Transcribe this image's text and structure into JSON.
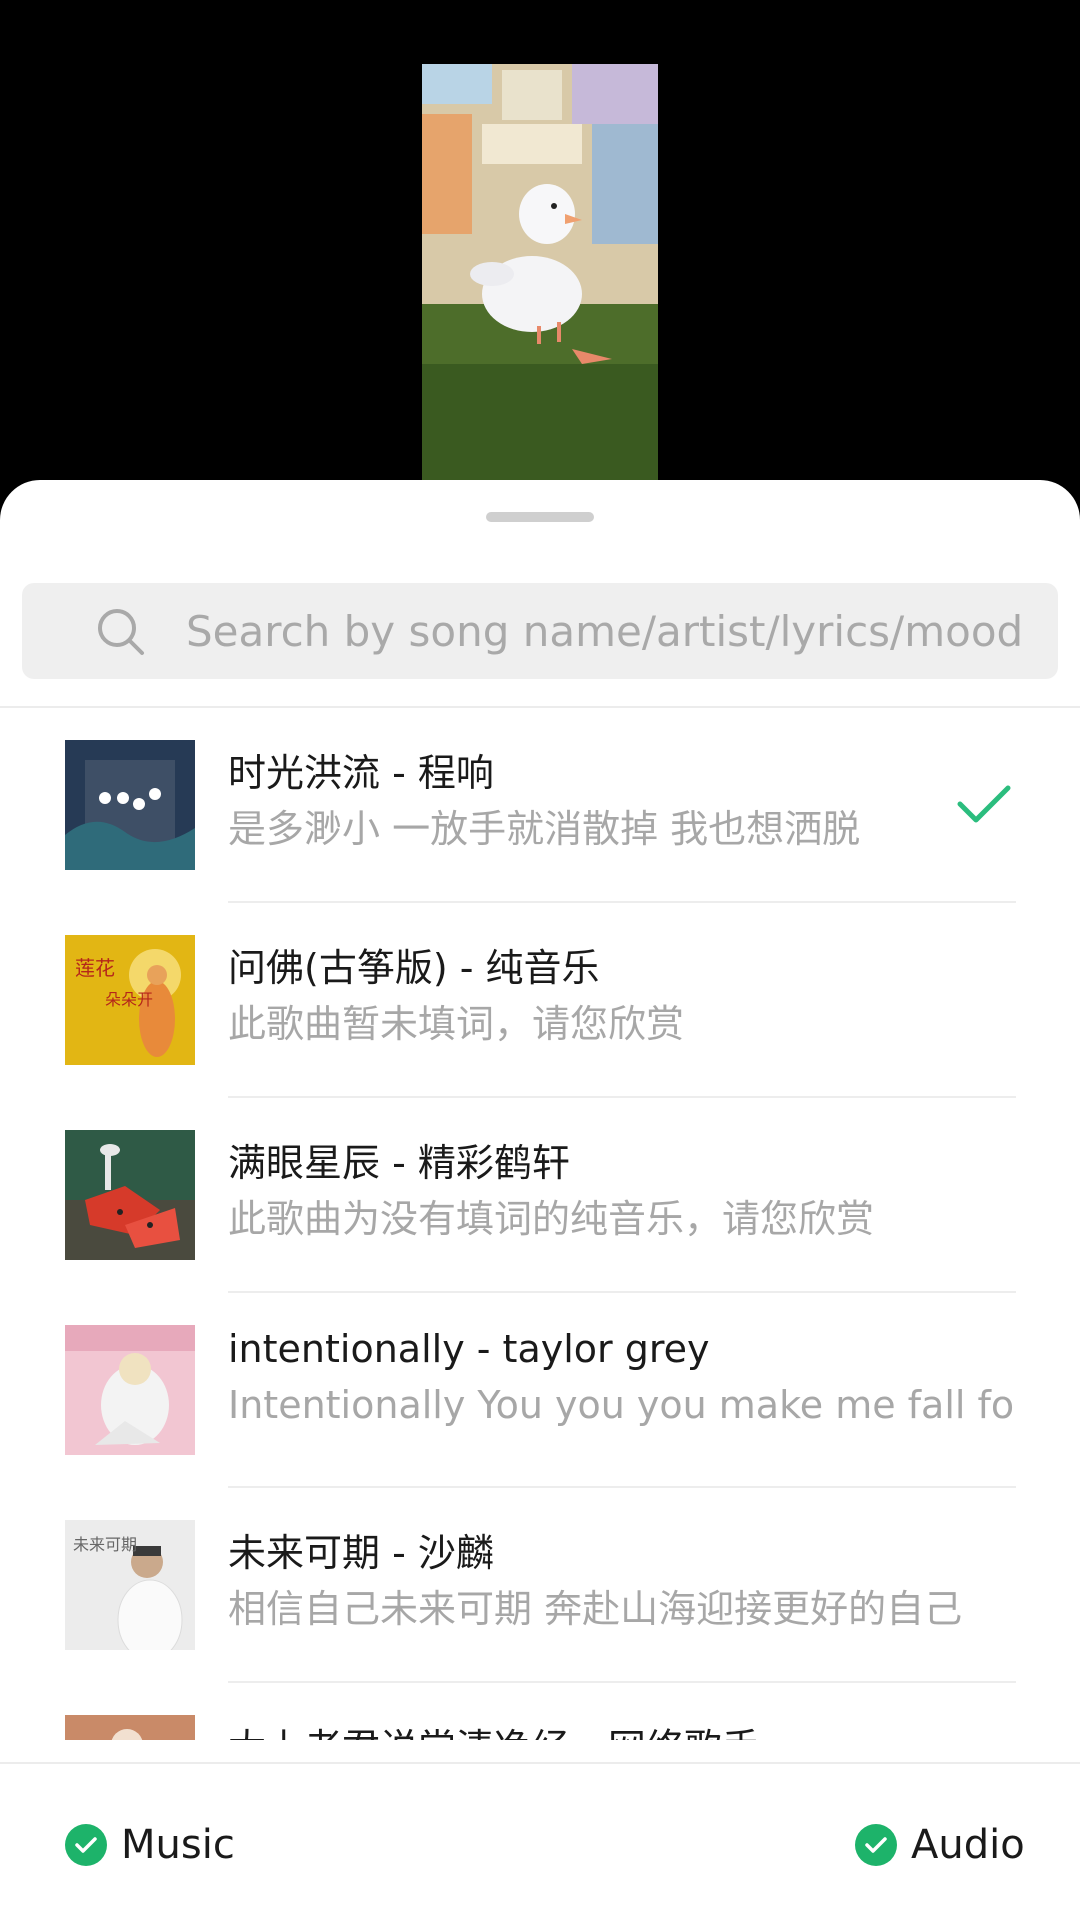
{
  "search": {
    "placeholder": "Search by song name/artist/lyrics/mood"
  },
  "songs": [
    {
      "title": "时光洪流 - 程响",
      "lyric": "是多渺小  一放手就消散掉  我也想洒脱",
      "selected": true
    },
    {
      "title": "问佛(古筝版) - 纯音乐",
      "lyric": "此歌曲暂未填词，请您欣赏",
      "cover_text": [
        "莲花",
        "朵朵开"
      ]
    },
    {
      "title": "满眼星辰 - 精彩鹤轩",
      "lyric": "此歌曲为没有填词的纯音乐，请您欣赏"
    },
    {
      "title": "intentionally - taylor grey",
      "lyric": "Intentionally  You you you make me fall for you"
    },
    {
      "title": "未来可期 - 沙麟",
      "lyric": "相信自己未来可期  奔赴山海迎接更好的自己",
      "cover_text": "未来可期"
    },
    {
      "title": "太上老君说常清净经 - 网络歌手",
      "lyric": ""
    }
  ],
  "footer": {
    "music_label": "Music",
    "audio_label": "Audio"
  },
  "colors": {
    "accent": "#1db36a",
    "check": "#2bbd7e"
  }
}
